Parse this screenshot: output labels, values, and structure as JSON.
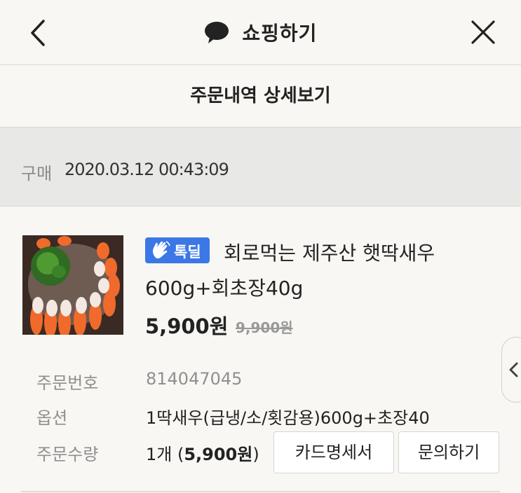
{
  "header": {
    "title": "쇼핑하기",
    "back_icon": "chevron-left-icon",
    "close_icon": "close-icon"
  },
  "page": {
    "title": "주문내역 상세보기"
  },
  "purchase": {
    "label": "구매",
    "datetime": "2020.03.12 00:43:09"
  },
  "product": {
    "badge": "톡딜",
    "name": "회로먹는 제주산 햇딱새우 600g+회초장40g",
    "price": "5,900원",
    "original_price": "9,900원"
  },
  "details": {
    "order_number_label": "주문번호",
    "order_number": "814047045",
    "option_label": "옵션",
    "option": "1딱새우(급냉/소/횟감용)600g+초장40",
    "quantity_label": "주문수량",
    "quantity_prefix": "1개 (",
    "quantity_price": "5,900원",
    "quantity_suffix": ")"
  },
  "buttons": {
    "card_receipt": "카드명세서",
    "inquiry": "문의하기"
  },
  "colors": {
    "badge": "#3b78e6",
    "background": "#f8f7f3",
    "date_bar": "#e8e8e6"
  }
}
